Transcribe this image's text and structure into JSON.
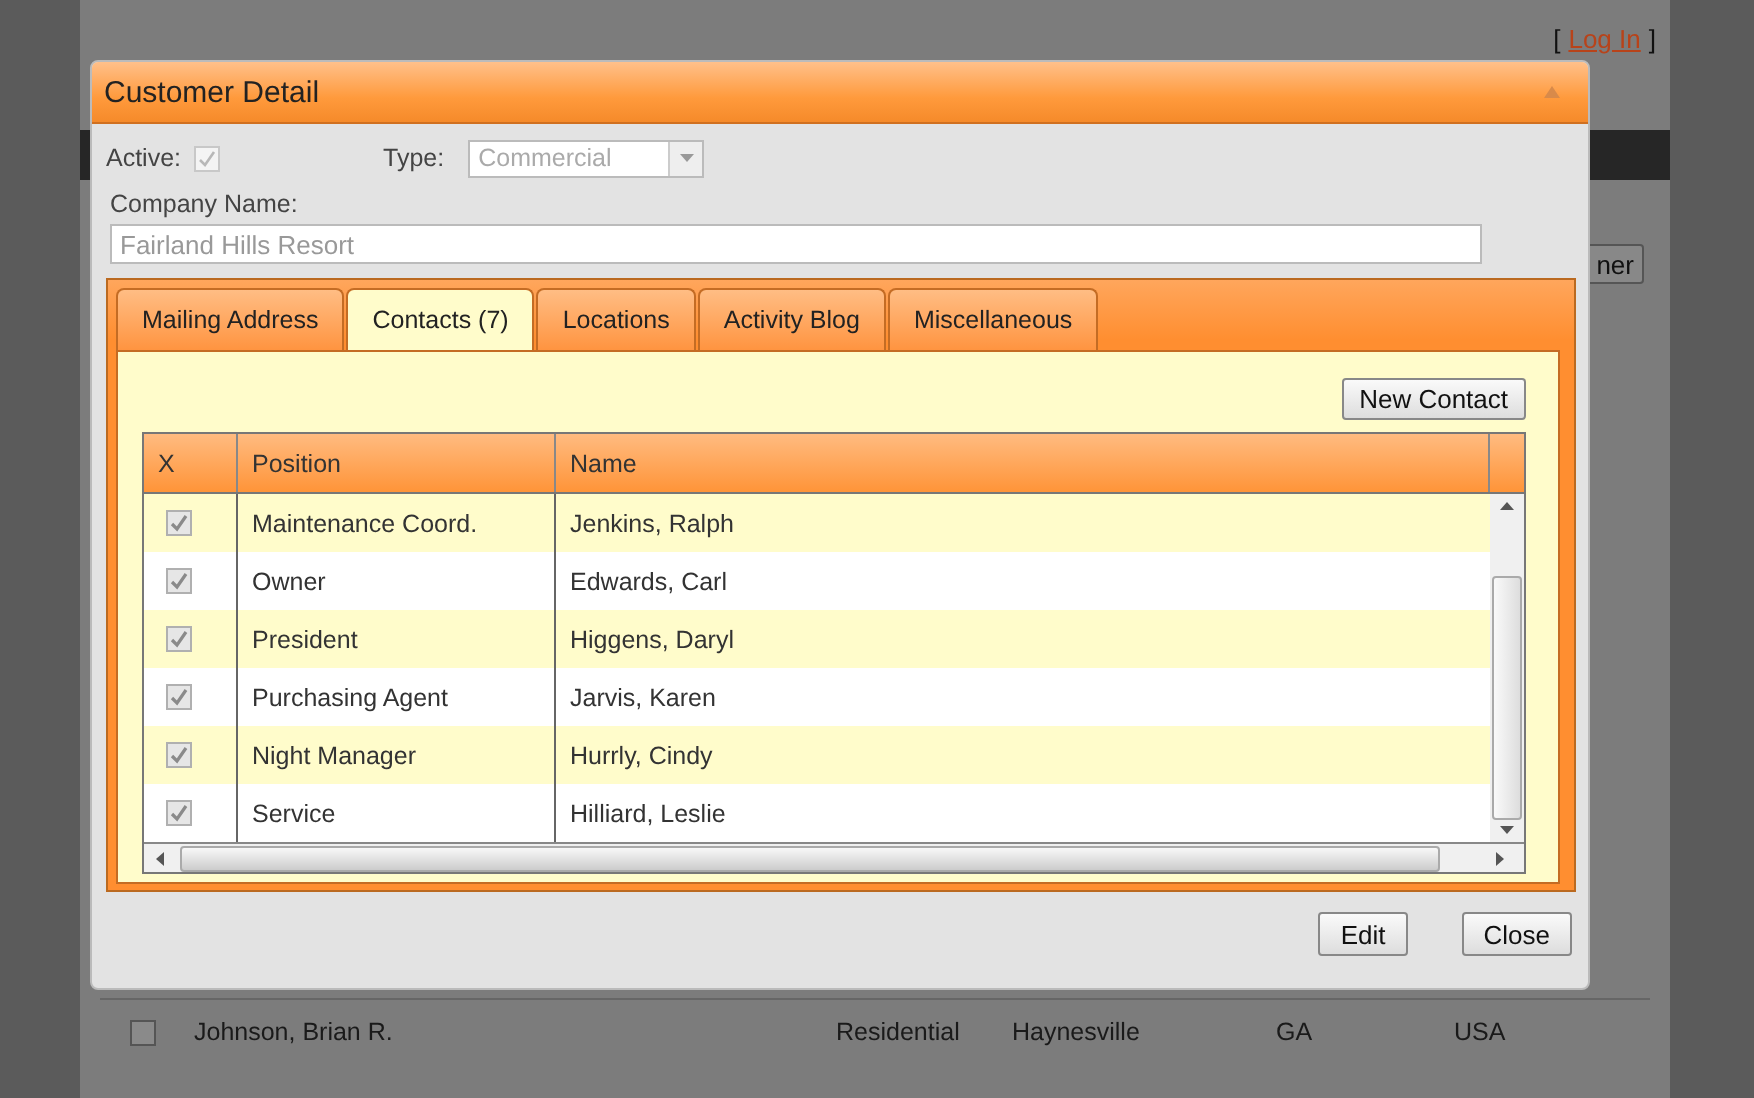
{
  "page": {
    "login_link": "Log In",
    "login_brackets": [
      "[",
      "]"
    ],
    "partial_button": "ner",
    "background_rows": [
      {
        "checked": false,
        "cells": [
          "Johnson, Brian R.",
          "Residential",
          "Haynesville",
          "GA",
          "USA"
        ]
      }
    ]
  },
  "dialog": {
    "title": "Customer Detail",
    "active": {
      "label": "Active:",
      "checked": true
    },
    "type": {
      "label": "Type:",
      "value": "Commercial"
    },
    "company": {
      "label": "Company Name:",
      "value": "Fairland Hills Resort"
    },
    "tabs": [
      {
        "label": "Mailing Address",
        "selected": false
      },
      {
        "label": "Contacts (7)",
        "selected": true
      },
      {
        "label": "Locations",
        "selected": false
      },
      {
        "label": "Activity Blog",
        "selected": false
      },
      {
        "label": "Miscellaneous",
        "selected": false
      }
    ],
    "new_contact_button": "New Contact",
    "table": {
      "columns": [
        "X",
        "Position",
        "Name"
      ],
      "rows": [
        {
          "checked": true,
          "position": "Maintenance Coord.",
          "name": "Jenkins, Ralph"
        },
        {
          "checked": true,
          "position": "Owner",
          "name": "Edwards, Carl"
        },
        {
          "checked": true,
          "position": "President",
          "name": "Higgens, Daryl"
        },
        {
          "checked": true,
          "position": "Purchasing Agent",
          "name": "Jarvis, Karen"
        },
        {
          "checked": true,
          "position": "Night Manager",
          "name": "Hurrly, Cindy"
        },
        {
          "checked": true,
          "position": "Service",
          "name": "Hilliard, Leslie"
        }
      ]
    },
    "buttons": [
      "Edit",
      "Close"
    ]
  }
}
